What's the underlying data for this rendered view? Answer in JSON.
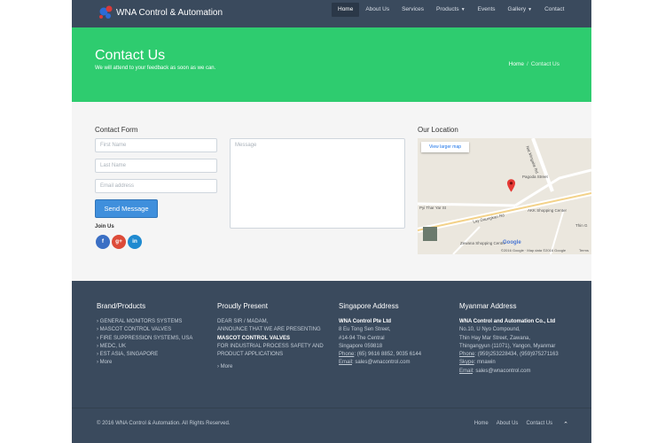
{
  "nav": {
    "brand": "WNA Control & Automation",
    "items": [
      {
        "label": "Home",
        "active": true,
        "dropdown": false
      },
      {
        "label": "About Us",
        "active": false,
        "dropdown": false
      },
      {
        "label": "Services",
        "active": false,
        "dropdown": false
      },
      {
        "label": "Products",
        "active": false,
        "dropdown": true
      },
      {
        "label": "Events",
        "active": false,
        "dropdown": false
      },
      {
        "label": "Gallery",
        "active": false,
        "dropdown": true
      },
      {
        "label": "Contact",
        "active": false,
        "dropdown": false
      }
    ]
  },
  "hero": {
    "title": "Contact Us",
    "subtitle": "We will attend to your feedback as soon as we can.",
    "breadcrumb": {
      "home": "Home",
      "separator": "/",
      "current": "Contact Us"
    }
  },
  "contact_form": {
    "heading": "Contact Form",
    "first_name_placeholder": "First Name",
    "last_name_placeholder": "Last Name",
    "email_placeholder": "Email address",
    "message_placeholder": "Message",
    "submit_label": "Send Message",
    "join_us": "Join Us",
    "social": [
      "f",
      "g+",
      "in"
    ]
  },
  "location": {
    "heading": "Our Location",
    "map_link": "View larger map",
    "labels": {
      "pagoda": "Pagoda Street",
      "pyi": "Pyi Thar Yar St",
      "lay": "Lay Daungkan Rd",
      "akk": "AKK Shopping Center",
      "zewana": "Zewana Shopping Centre",
      "thin": "Thin G",
      "mingalar": "Nat Mingalar Rd",
      "google": "Google",
      "attribution": "©2016 Google · Map data ©2016 Google",
      "terms": "Terms"
    }
  },
  "footer": {
    "brand": {
      "heading": "Brand/Products",
      "items": [
        "› GENERAL MONITORS SYSTEMS",
        "› MASCOT CONTROL VALVES",
        "› FIRE SUPPRESSION SYSTEMS, USA",
        "› MEDC, UK",
        "› EST ASIA, SINGAPORE",
        "› More"
      ]
    },
    "present": {
      "heading": "Proudly Present",
      "line1": "DEAR SIR / MADAM,",
      "line2": "ANNOUNCE THAT WE ARE PRESENTING",
      "line3": "MASCOT CONTROL VALVES",
      "line4": "FOR INDUSTRIAL PROCESS SAFETY AND",
      "line5": "PRODUCT APPLICATIONS",
      "more": "› More"
    },
    "singapore": {
      "heading": "Singapore Address",
      "company": "WNA Control Pte Ltd",
      "addr1": "8 Eu Tong Sen Street,",
      "addr2": "#14-94 The Central",
      "addr3": "Singapore 059818",
      "phone_label": "Phone",
      "phone": ": (65) 9616 8852, 9035 6144",
      "email_label": "Email",
      "email": ": sales@wnacontrol.com"
    },
    "myanmar": {
      "heading": "Myanmar Address",
      "company": "WNA Control and Automation Co., Ltd",
      "addr1": "No.10, U Nyo Compound,",
      "addr2": "Thin Hay Mar Street, Zawana,",
      "addr3": "Thingangyun (11071), Yangon, Myanmar",
      "phone_label": "Phone",
      "phone": ": (959)253228434, (959)975271163",
      "skype_label": "Skype",
      "skype": ": mnawin",
      "email_label": "Email",
      "email": ": sales@wnacontrol.com"
    },
    "copyright": "© 2016 WNA Control & Automation. All Rights Reserved.",
    "links": [
      "Home",
      "About Us",
      "Contact Us"
    ],
    "top_icon": "chevron-up-icon"
  },
  "colors": {
    "nav_bg": "#3a4a5d",
    "hero_bg": "#2ecc6f",
    "button": "#3f8fdc",
    "facebook": "#3b6fc4",
    "google": "#dd4b39",
    "linkedin": "#1f8ad0"
  }
}
